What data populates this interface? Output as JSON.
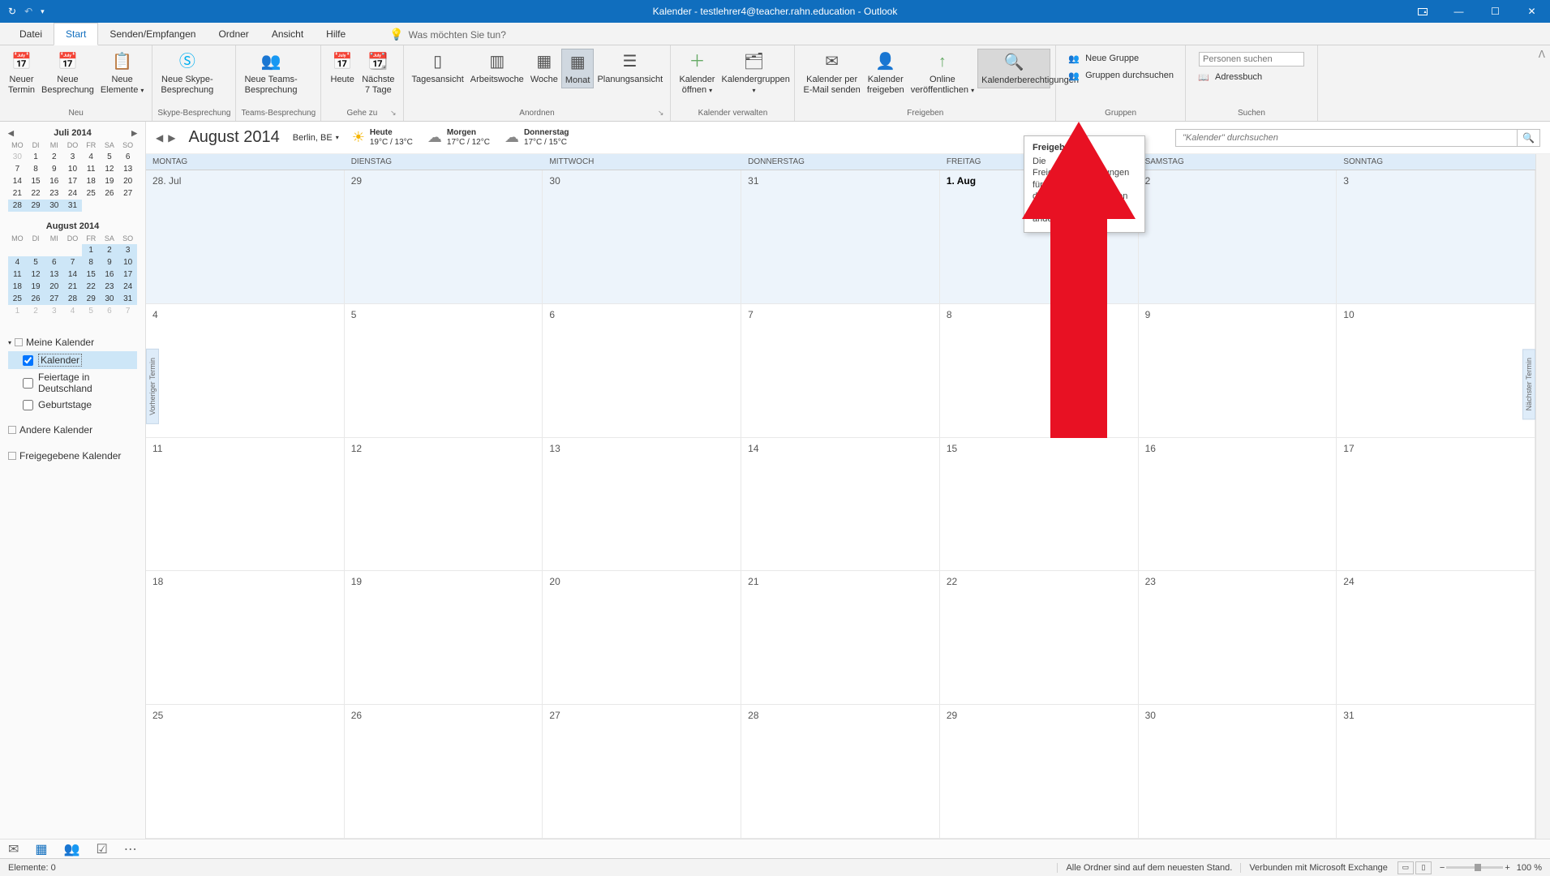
{
  "window_title": "Kalender - testlehrer4@teacher.rahn.education - Outlook",
  "ribbon_tabs": {
    "file": "Datei",
    "start": "Start",
    "send_receive": "Senden/Empfangen",
    "folder": "Ordner",
    "view": "Ansicht",
    "help": "Hilfe",
    "tell_me_placeholder": "Was möchten Sie tun?"
  },
  "ribbon": {
    "group_new": "Neu",
    "new_appointment_l1": "Neuer",
    "new_appointment_l2": "Termin",
    "new_meeting_l1": "Neue",
    "new_meeting_l2": "Besprechung",
    "new_items_l1": "Neue",
    "new_items_l2": "Elemente",
    "group_skype": "Skype-Besprechung",
    "new_skype_l1": "Neue Skype-",
    "new_skype_l2": "Besprechung",
    "group_teams": "Teams-Besprechung",
    "new_teams_l1": "Neue Teams-",
    "new_teams_l2": "Besprechung",
    "group_goto": "Gehe zu",
    "today": "Heute",
    "next7_l1": "Nächste",
    "next7_l2": "7 Tage",
    "group_arrange": "Anordnen",
    "day_view": "Tagesansicht",
    "work_week": "Arbeitswoche",
    "week": "Woche",
    "month": "Monat",
    "schedule_view": "Planungsansicht",
    "group_manage": "Kalender verwalten",
    "open_cal_l1": "Kalender",
    "open_cal_l2": "öffnen",
    "cal_groups": "Kalendergruppen",
    "group_share": "Freigeben",
    "email_cal_l1": "Kalender per",
    "email_cal_l2": "E-Mail senden",
    "share_cal_l1": "Kalender",
    "share_cal_l2": "freigeben",
    "publish_online_l1": "Online",
    "publish_online_l2": "veröffentlichen",
    "cal_permissions": "Kalenderberechtigungen",
    "group_groups": "Gruppen",
    "new_group": "Neue Gruppe",
    "browse_groups": "Gruppen durchsuchen",
    "group_search": "Suchen",
    "search_people_placeholder": "Personen suchen",
    "address_book": "Adressbuch"
  },
  "tooltip": {
    "title": "Freigeben",
    "body_l1": "Die Freigabeberechtigungen für",
    "body_l2": "diesen Ordner anzeigen und",
    "body_l3": "ändern."
  },
  "mini_cal_dow": [
    "MO",
    "DI",
    "MI",
    "DO",
    "FR",
    "SA",
    "SO"
  ],
  "mini_cal_1": {
    "title": "Juli 2014",
    "rows": [
      [
        {
          "d": "30",
          "o": true
        },
        {
          "d": "1"
        },
        {
          "d": "2"
        },
        {
          "d": "3"
        },
        {
          "d": "4"
        },
        {
          "d": "5"
        },
        {
          "d": "6"
        }
      ],
      [
        {
          "d": "7"
        },
        {
          "d": "8"
        },
        {
          "d": "9"
        },
        {
          "d": "10"
        },
        {
          "d": "11"
        },
        {
          "d": "12"
        },
        {
          "d": "13"
        }
      ],
      [
        {
          "d": "14"
        },
        {
          "d": "15"
        },
        {
          "d": "16"
        },
        {
          "d": "17"
        },
        {
          "d": "18"
        },
        {
          "d": "19"
        },
        {
          "d": "20"
        }
      ],
      [
        {
          "d": "21"
        },
        {
          "d": "22"
        },
        {
          "d": "23"
        },
        {
          "d": "24"
        },
        {
          "d": "25"
        },
        {
          "d": "26"
        },
        {
          "d": "27"
        }
      ],
      [
        {
          "d": "28",
          "h": true
        },
        {
          "d": "29",
          "h": true
        },
        {
          "d": "30",
          "h": true
        },
        {
          "d": "31",
          "h": true
        },
        {
          "d": "",
          "o": true
        },
        {
          "d": "",
          "o": true
        },
        {
          "d": "",
          "o": true
        }
      ]
    ]
  },
  "mini_cal_2": {
    "title": "August 2014",
    "rows": [
      [
        {
          "d": "",
          "o": true
        },
        {
          "d": "",
          "o": true
        },
        {
          "d": "",
          "o": true
        },
        {
          "d": "",
          "o": true
        },
        {
          "d": "1",
          "h": true
        },
        {
          "d": "2",
          "h": true
        },
        {
          "d": "3",
          "h": true
        }
      ],
      [
        {
          "d": "4",
          "h": true
        },
        {
          "d": "5",
          "h": true
        },
        {
          "d": "6",
          "h": true
        },
        {
          "d": "7",
          "h": true
        },
        {
          "d": "8",
          "h": true
        },
        {
          "d": "9",
          "h": true
        },
        {
          "d": "10",
          "h": true
        }
      ],
      [
        {
          "d": "11",
          "h": true
        },
        {
          "d": "12",
          "h": true
        },
        {
          "d": "13",
          "h": true
        },
        {
          "d": "14",
          "h": true
        },
        {
          "d": "15",
          "h": true
        },
        {
          "d": "16",
          "h": true
        },
        {
          "d": "17",
          "h": true
        }
      ],
      [
        {
          "d": "18",
          "h": true
        },
        {
          "d": "19",
          "h": true
        },
        {
          "d": "20",
          "h": true
        },
        {
          "d": "21",
          "h": true
        },
        {
          "d": "22",
          "h": true
        },
        {
          "d": "23",
          "h": true
        },
        {
          "d": "24",
          "h": true
        }
      ],
      [
        {
          "d": "25",
          "h": true
        },
        {
          "d": "26",
          "h": true
        },
        {
          "d": "27",
          "h": true
        },
        {
          "d": "28",
          "h": true
        },
        {
          "d": "29",
          "h": true
        },
        {
          "d": "30",
          "h": true
        },
        {
          "d": "31",
          "h": true
        }
      ],
      [
        {
          "d": "1",
          "o": true
        },
        {
          "d": "2",
          "o": true
        },
        {
          "d": "3",
          "o": true
        },
        {
          "d": "4",
          "o": true
        },
        {
          "d": "5",
          "o": true
        },
        {
          "d": "6",
          "o": true
        },
        {
          "d": "7",
          "o": true
        }
      ]
    ]
  },
  "cal_tree": {
    "my_calendars": "Meine Kalender",
    "kalender": "Kalender",
    "holidays": "Feiertage in Deutschland",
    "birthdays": "Geburtstage",
    "other_calendars": "Andere Kalender",
    "shared_calendars": "Freigegebene Kalender"
  },
  "main_cal": {
    "title": "August 2014",
    "location": "Berlin, BE",
    "weather": [
      {
        "day": "Heute",
        "temp": "19°C / 13°C",
        "icon": "sun"
      },
      {
        "day": "Morgen",
        "temp": "17°C / 12°C",
        "icon": "cloud"
      },
      {
        "day": "Donnerstag",
        "temp": "17°C / 15°C",
        "icon": "cloud"
      }
    ],
    "search_placeholder": "\"Kalender\" durchsuchen",
    "dow": [
      "MONTAG",
      "DIENSTAG",
      "MITTWOCH",
      "DONNERSTAG",
      "FREITAG",
      "SAMSTAG",
      "SONNTAG"
    ],
    "days": [
      [
        {
          "l": "28. Jul"
        },
        {
          "l": "29"
        },
        {
          "l": "30"
        },
        {
          "l": "31"
        },
        {
          "l": "1. Aug",
          "f": true
        },
        {
          "l": "2"
        },
        {
          "l": "3"
        }
      ],
      [
        {
          "l": "4"
        },
        {
          "l": "5"
        },
        {
          "l": "6"
        },
        {
          "l": "7"
        },
        {
          "l": "8"
        },
        {
          "l": "9"
        },
        {
          "l": "10"
        }
      ],
      [
        {
          "l": "11"
        },
        {
          "l": "12"
        },
        {
          "l": "13"
        },
        {
          "l": "14"
        },
        {
          "l": "15"
        },
        {
          "l": "16"
        },
        {
          "l": "17"
        }
      ],
      [
        {
          "l": "18"
        },
        {
          "l": "19"
        },
        {
          "l": "20"
        },
        {
          "l": "21"
        },
        {
          "l": "22"
        },
        {
          "l": "23"
        },
        {
          "l": "24"
        }
      ],
      [
        {
          "l": "25"
        },
        {
          "l": "26"
        },
        {
          "l": "27"
        },
        {
          "l": "28"
        },
        {
          "l": "29"
        },
        {
          "l": "30"
        },
        {
          "l": "31"
        }
      ]
    ]
  },
  "side_tabs": {
    "prev": "Vorheriger Termin",
    "next": "Nächster Termin"
  },
  "status": {
    "items": "Elemente: 0",
    "folders_updated": "Alle Ordner sind auf dem neuesten Stand.",
    "connected": "Verbunden mit Microsoft Exchange",
    "zoom": "100 %"
  }
}
